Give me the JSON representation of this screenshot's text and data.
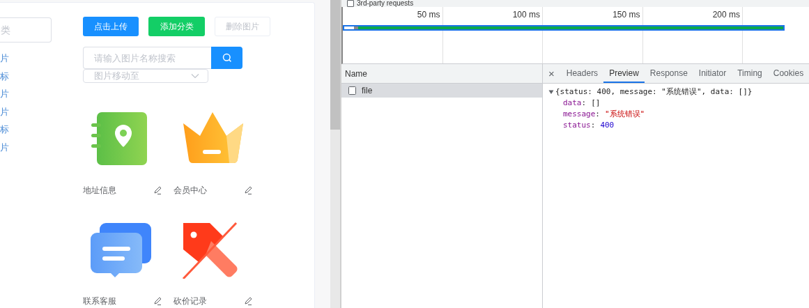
{
  "gallery": {
    "category_search": {
      "placeholder": "类"
    },
    "categories": [
      {
        "label": "片"
      },
      {
        "label": "标"
      },
      {
        "label": "片"
      },
      {
        "label": "片"
      },
      {
        "label": "标"
      },
      {
        "label": "片"
      }
    ],
    "buttons": [
      {
        "label": "点击上传",
        "kind": "primary",
        "disabled": false
      },
      {
        "label": "添加分类",
        "kind": "success",
        "disabled": false
      },
      {
        "label": "删除图片",
        "kind": "plain",
        "disabled": true
      }
    ],
    "search": {
      "placeholder": "请输入图片名称搜索"
    },
    "move_select": {
      "placeholder": "图片移动至"
    },
    "images": [
      {
        "label": "地址信息",
        "kind": "location"
      },
      {
        "label": "会员中心",
        "kind": "crown"
      },
      {
        "label": "联系客服",
        "kind": "chat"
      },
      {
        "label": "砍价记录",
        "kind": "tag"
      }
    ]
  },
  "devtools": {
    "filter": {
      "label": "3rd-party requests",
      "checked": false
    },
    "timeline": {
      "ticks": [
        "50 ms",
        "100 ms",
        "150 ms",
        "200 ms"
      ]
    },
    "requests_table": {
      "column": "Name",
      "rows": [
        {
          "name": "file",
          "selected": true
        }
      ]
    },
    "detail": {
      "close": "×",
      "tabs": [
        {
          "label": "Headers",
          "selected": false
        },
        {
          "label": "Preview",
          "selected": true
        },
        {
          "label": "Response",
          "selected": false
        },
        {
          "label": "Initiator",
          "selected": false
        },
        {
          "label": "Timing",
          "selected": false
        },
        {
          "label": "Cookies",
          "selected": false
        }
      ],
      "preview": {
        "summary": "{status: 400, message: \"系统错误\", data: []}",
        "expanded": true,
        "properties": [
          {
            "key": "data",
            "separator": ":",
            "value": "[]",
            "kind": "array"
          },
          {
            "key": "message",
            "separator": ":",
            "value": "\"系统错误\"",
            "kind": "string"
          },
          {
            "key": "status",
            "separator": ":",
            "value": "400",
            "kind": "number"
          }
        ]
      }
    }
  }
}
